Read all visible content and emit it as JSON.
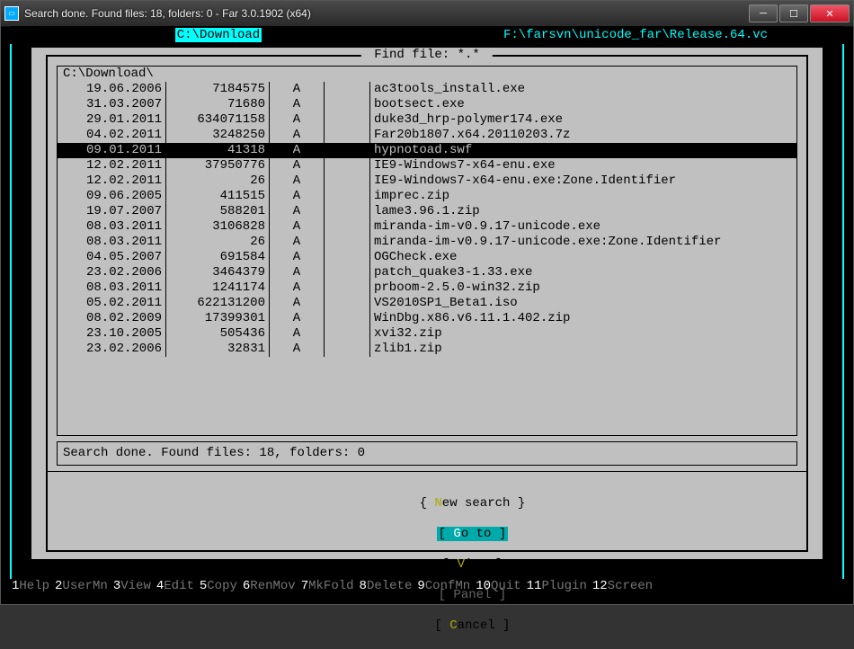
{
  "window": {
    "title": "Search done. Found files: 18, folders: 0 - Far 3.0.1902 (x64)"
  },
  "panels": {
    "left": "C:\\Download",
    "right": "F:\\farsvn\\unicode_far\\Release.64.vc"
  },
  "dialog": {
    "title": " Find file: *.* ",
    "path": "C:\\Download\\",
    "rows": [
      {
        "date": "19.06.2006",
        "size": "7184575",
        "attr": "A",
        "name": "ac3tools_install.exe",
        "sel": false
      },
      {
        "date": "31.03.2007",
        "size": "71680",
        "attr": "A",
        "name": "bootsect.exe",
        "sel": false
      },
      {
        "date": "29.01.2011",
        "size": "634071158",
        "attr": "A",
        "name": "duke3d_hrp-polymer174.exe",
        "sel": false
      },
      {
        "date": "04.02.2011",
        "size": "3248250",
        "attr": "A",
        "name": "Far20b1807.x64.20110203.7z",
        "sel": false
      },
      {
        "date": "09.01.2011",
        "size": "41318",
        "attr": "A",
        "name": "hypnotoad.swf",
        "sel": true
      },
      {
        "date": "12.02.2011",
        "size": "37950776",
        "attr": "A",
        "name": "IE9-Windows7-x64-enu.exe",
        "sel": false
      },
      {
        "date": "12.02.2011",
        "size": "26",
        "attr": "A",
        "name": "IE9-Windows7-x64-enu.exe:Zone.Identifier",
        "sel": false
      },
      {
        "date": "09.06.2005",
        "size": "411515",
        "attr": "A",
        "name": "imprec.zip",
        "sel": false
      },
      {
        "date": "19.07.2007",
        "size": "588201",
        "attr": "A",
        "name": "lame3.96.1.zip",
        "sel": false
      },
      {
        "date": "08.03.2011",
        "size": "3106828",
        "attr": "A",
        "name": "miranda-im-v0.9.17-unicode.exe",
        "sel": false
      },
      {
        "date": "08.03.2011",
        "size": "26",
        "attr": "A",
        "name": "miranda-im-v0.9.17-unicode.exe:Zone.Identifier",
        "sel": false
      },
      {
        "date": "04.05.2007",
        "size": "691584",
        "attr": "A",
        "name": "OGCheck.exe",
        "sel": false
      },
      {
        "date": "23.02.2006",
        "size": "3464379",
        "attr": "A",
        "name": "patch_quake3-1.33.exe",
        "sel": false
      },
      {
        "date": "08.03.2011",
        "size": "1241174",
        "attr": "A",
        "name": "prboom-2.5.0-win32.zip",
        "sel": false
      },
      {
        "date": "05.02.2011",
        "size": "622131200",
        "attr": "A",
        "name": "VS2010SP1_Beta1.iso",
        "sel": false
      },
      {
        "date": "08.02.2009",
        "size": "17399301",
        "attr": "A",
        "name": "WinDbg.x86.v6.11.1.402.zip",
        "sel": false
      },
      {
        "date": "23.10.2005",
        "size": "505436",
        "attr": "A",
        "name": "xvi32.zip",
        "sel": false
      },
      {
        "date": "23.02.2006",
        "size": "32831",
        "attr": "A",
        "name": "zlib1.zip",
        "sel": false
      }
    ],
    "status": "Search done. Found files: 18, folders: 0",
    "buttons": {
      "new_search": {
        "hl": "N",
        "rest": "ew search"
      },
      "goto": {
        "hl": "G",
        "rest": "o to"
      },
      "view": {
        "hl": "V",
        "rest": "iew"
      },
      "panel": {
        "hl": "P",
        "rest": "anel"
      },
      "cancel": {
        "hl": "C",
        "rest": "ancel"
      }
    }
  },
  "keybar": [
    {
      "n": "1",
      "l": "Help"
    },
    {
      "n": "2",
      "l": "UserMn"
    },
    {
      "n": "3",
      "l": "View"
    },
    {
      "n": "4",
      "l": "Edit"
    },
    {
      "n": "5",
      "l": "Copy"
    },
    {
      "n": "6",
      "l": "RenMov"
    },
    {
      "n": "7",
      "l": "MkFold"
    },
    {
      "n": "8",
      "l": "Delete"
    },
    {
      "n": "9",
      "l": "ConfMn"
    },
    {
      "n": "10",
      "l": "Quit"
    },
    {
      "n": "11",
      "l": "Plugin"
    },
    {
      "n": "12",
      "l": "Screen"
    }
  ]
}
